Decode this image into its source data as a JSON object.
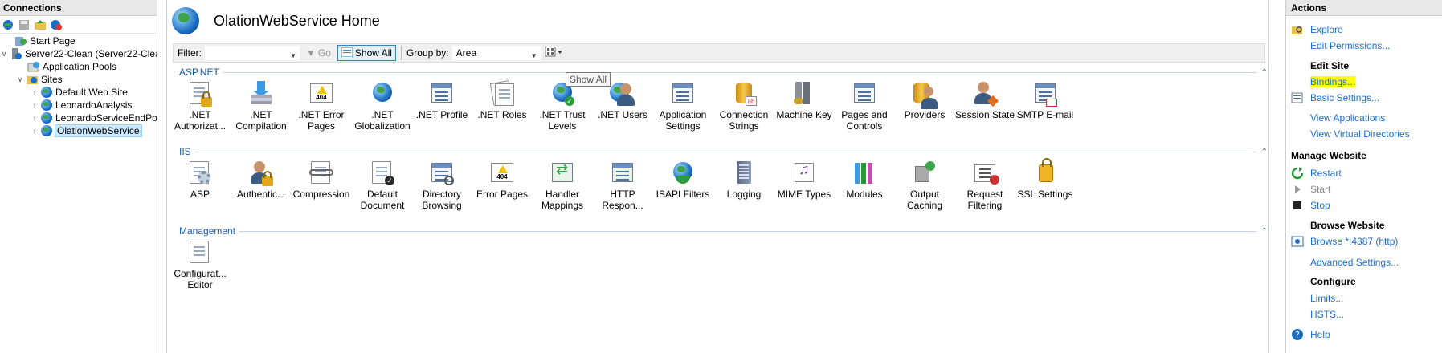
{
  "connections": {
    "header": "Connections",
    "tree": [
      {
        "label": "Start Page",
        "level": 0
      },
      {
        "label": "Server22-Clean (Server22-Clea",
        "level": 0
      },
      {
        "label": "Application Pools",
        "level": 1
      },
      {
        "label": "Sites",
        "level": 1
      },
      {
        "label": "Default Web Site",
        "level": 2
      },
      {
        "label": "LeonardoAnalysis",
        "level": 2
      },
      {
        "label": "LeonardoServiceEndPo",
        "level": 2
      },
      {
        "label": "OlationWebService",
        "level": 2,
        "selected": true
      }
    ]
  },
  "main": {
    "title": "OlationWebService Home",
    "filter_label": "Filter:",
    "filter_value": "",
    "go_label": "Go",
    "show_all_label": "Show All",
    "group_by_label": "Group by:",
    "group_by_value": "Area",
    "tooltip": "Show All",
    "groups": [
      {
        "name": "ASP.NET",
        "features": [
          ".NET Authorizat...",
          ".NET Compilation",
          ".NET Error Pages",
          ".NET Globalization",
          ".NET Profile",
          ".NET Roles",
          ".NET Trust Levels",
          ".NET Users",
          "Application Settings",
          "Connection Strings",
          "Machine Key",
          "Pages and Controls",
          "Providers",
          "Session State",
          "SMTP E-mail"
        ]
      },
      {
        "name": "IIS",
        "features": [
          "ASP",
          "Authentic...",
          "Compression",
          "Default Document",
          "Directory Browsing",
          "Error Pages",
          "Handler Mappings",
          "HTTP Respon...",
          "ISAPI Filters",
          "Logging",
          "MIME Types",
          "Modules",
          "Output Caching",
          "Request Filtering",
          "SSL Settings"
        ]
      },
      {
        "name": "Management",
        "features": [
          "Configurat... Editor"
        ]
      }
    ]
  },
  "actions": {
    "header": "Actions",
    "explore": "Explore",
    "edit_permissions": "Edit Permissions...",
    "edit_site_header": "Edit Site",
    "bindings": "Bindings...",
    "basic_settings": "Basic Settings...",
    "view_applications": "View Applications",
    "view_virtual_directories": "View Virtual Directories",
    "manage_website_header": "Manage Website",
    "restart": "Restart",
    "start": "Start",
    "stop": "Stop",
    "browse_website_header": "Browse Website",
    "browse_link": "Browse *:4387 (http)",
    "advanced_settings": "Advanced Settings...",
    "configure_header": "Configure",
    "limits": "Limits...",
    "hsts": "HSTS...",
    "help": "Help"
  }
}
